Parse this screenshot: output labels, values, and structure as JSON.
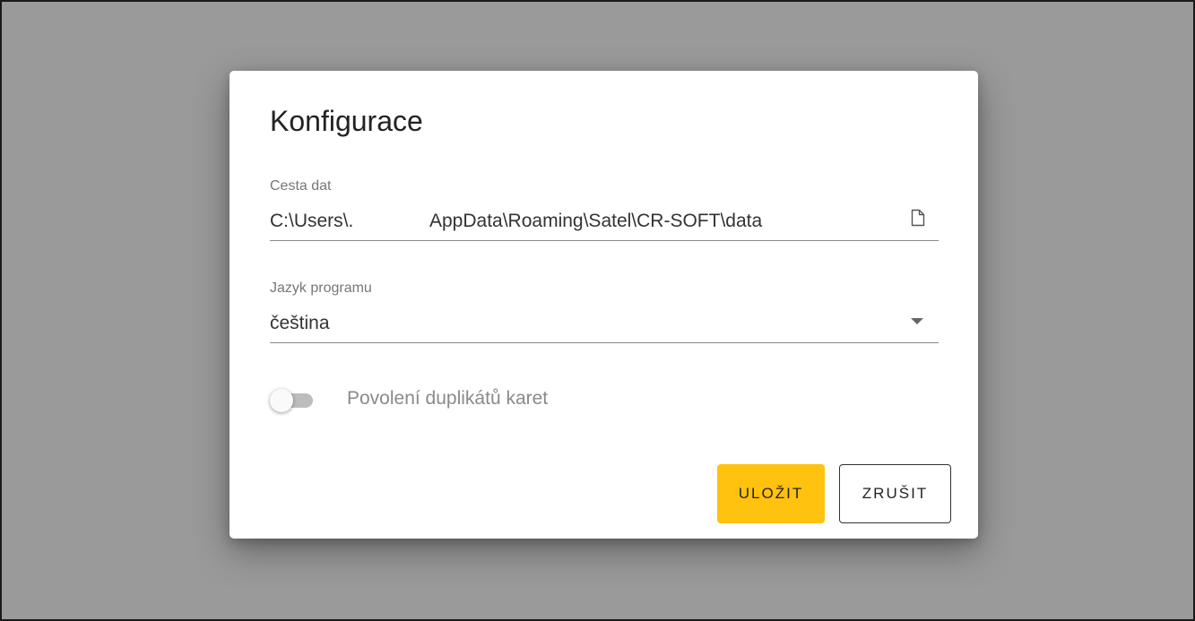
{
  "dialog": {
    "title": "Konfigurace",
    "data_path": {
      "label": "Cesta dat",
      "value_start": "C:\\Users\\.",
      "value_end": "AppData\\Roaming\\Satel\\CR-SOFT\\data",
      "icon": "file-icon"
    },
    "language": {
      "label": "Jazyk programu",
      "value": "čeština",
      "icon": "dropdown-arrow-icon"
    },
    "duplicates_toggle": {
      "label": "Povolení duplikátů karet",
      "checked": false
    },
    "buttons": {
      "save_label": "ULOŽIT",
      "cancel_label": "ZRUŠIT"
    }
  },
  "colors": {
    "backdrop": "#9a9a9a",
    "accent": "#ffc20e",
    "dialog_bg": "#ffffff"
  }
}
